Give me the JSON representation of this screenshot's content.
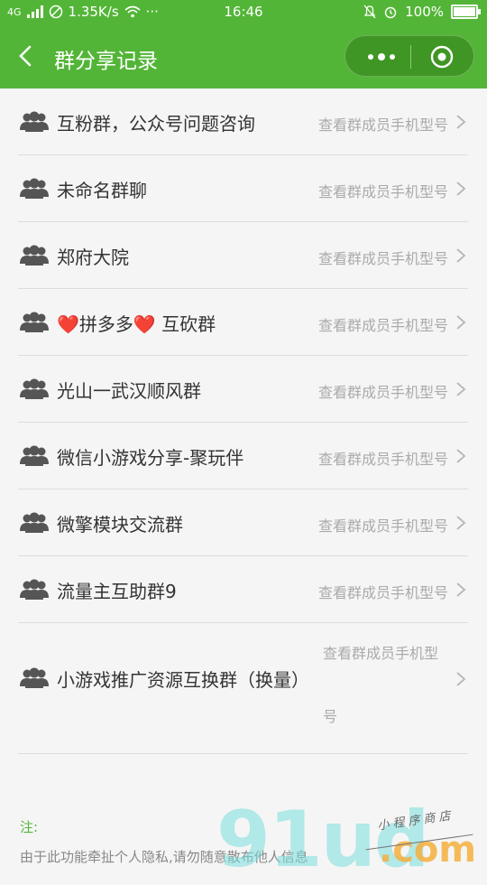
{
  "status_bar": {
    "network": "4G",
    "speed": "1.35K/s",
    "time": "16:46",
    "battery": "100%"
  },
  "header": {
    "title": "群分享记录",
    "back_icon": "chevron-left-icon",
    "menu_icon": "more-dots-icon",
    "close_icon": "target-circle-icon"
  },
  "groups": [
    {
      "name": "互粉群，公众号问题咨询",
      "hint": "查看群成员手机型号"
    },
    {
      "name": "未命名群聊",
      "hint": "查看群成员手机型号"
    },
    {
      "name": "郑府大院",
      "hint": "查看群成员手机型号"
    },
    {
      "name_pre": "❤️",
      "name_mid": "拼多多",
      "name_post": "❤️",
      "name_tail": " 互砍群",
      "hint": "查看群成员手机型号"
    },
    {
      "name": "光山一武汉顺风群",
      "hint": "查看群成员手机型号"
    },
    {
      "name": "微信小游戏分享-聚玩伴",
      "hint": "查看群成员手机型号"
    },
    {
      "name": "微擎模块交流群",
      "hint": "查看群成员手机型号"
    },
    {
      "name": "流量主互助群9",
      "hint": "查看群成员手机型号"
    },
    {
      "name": "小游戏推广资源互换群（换量）",
      "hint_line1": "查看群成员手机型",
      "hint_line2": "号"
    }
  ],
  "footer": {
    "note_label": "注:",
    "notice": "由于此功能牵扯个人隐私,请勿随意散布他人信息"
  },
  "watermark": {
    "brand": "91ud",
    "domain": ".com",
    "tagline": "小 程 序 商 店"
  },
  "colors": {
    "accent": "#53b537",
    "hint": "#aaaaaa",
    "text": "#333333"
  }
}
